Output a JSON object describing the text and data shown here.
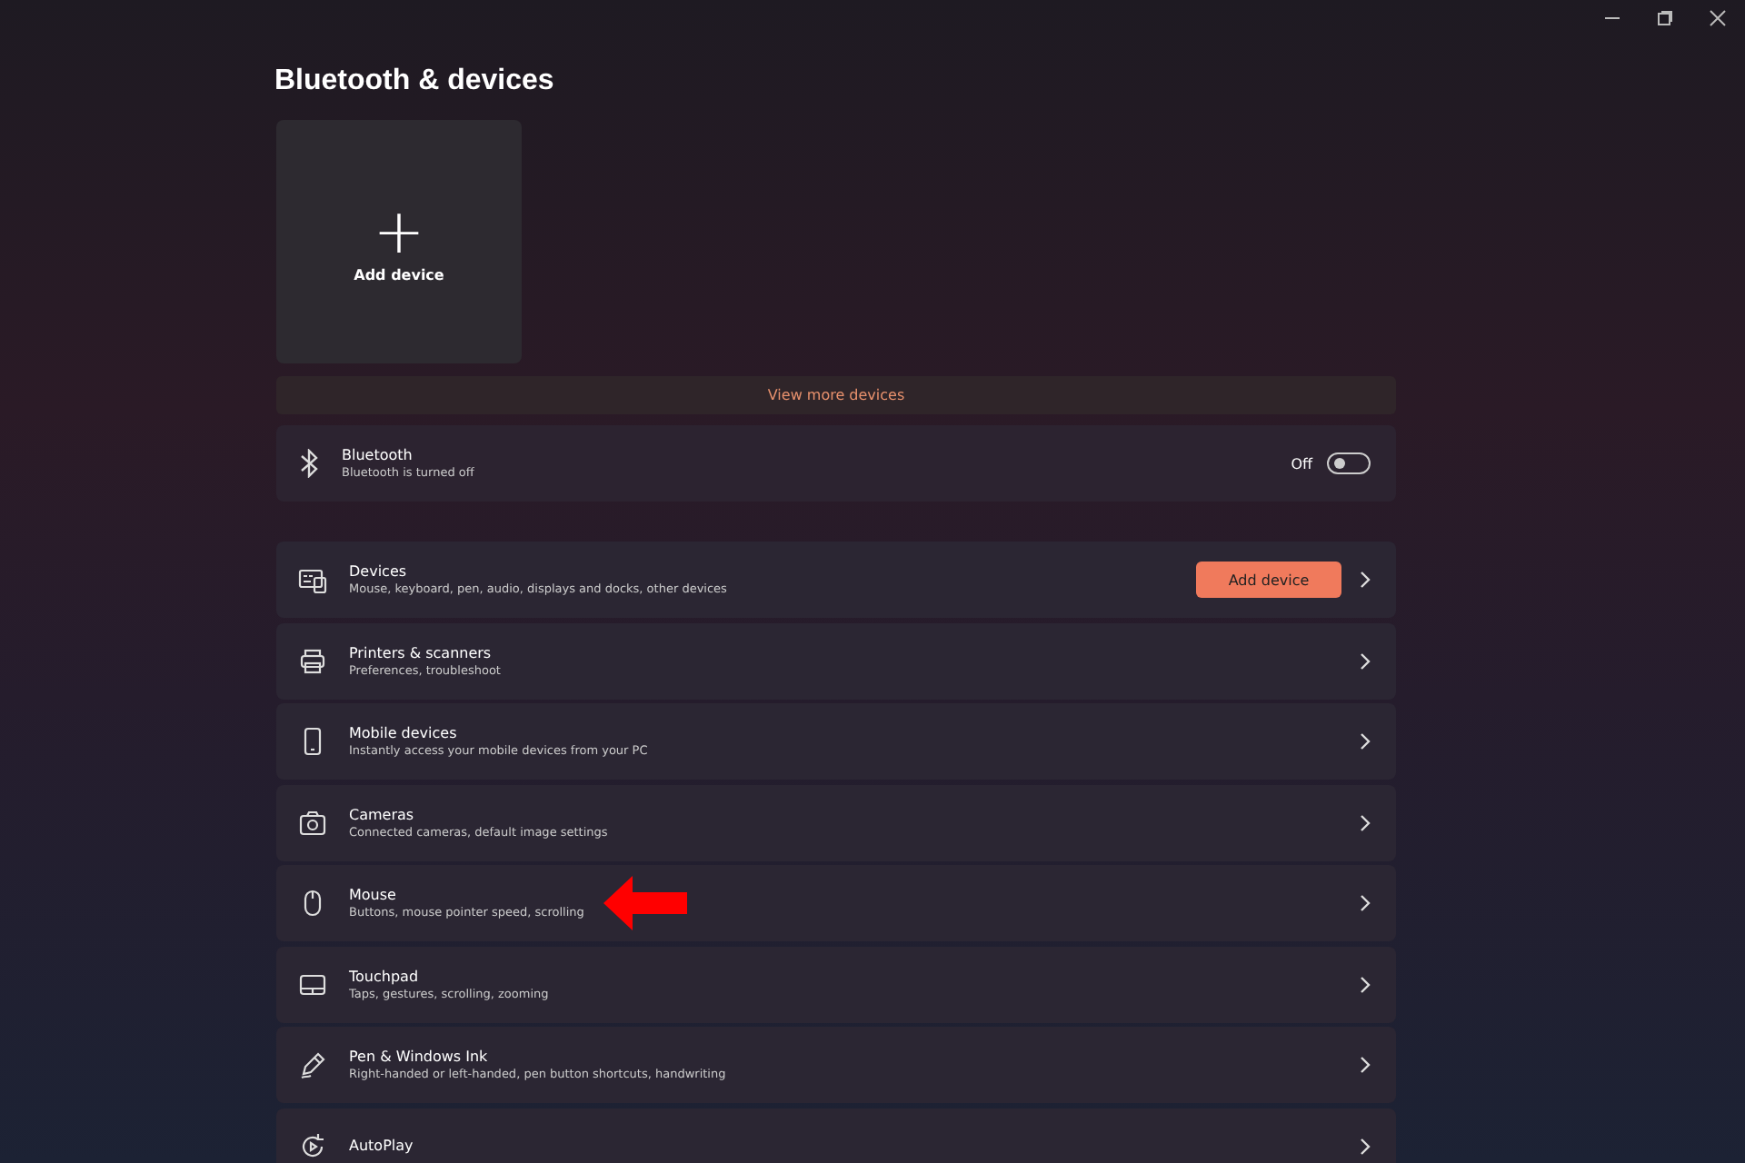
{
  "page_title": "Bluetooth & devices",
  "add_tile": {
    "plus": "+",
    "label": "Add device"
  },
  "view_more": "View more devices",
  "bluetooth": {
    "title": "Bluetooth",
    "subtitle": "Bluetooth is turned off",
    "state_label": "Off",
    "on": false
  },
  "items": [
    {
      "title": "Devices",
      "subtitle": "Mouse, keyboard, pen, audio, displays and docks, other devices",
      "button": "Add device",
      "highlighted": false
    },
    {
      "title": "Printers & scanners",
      "subtitle": "Preferences, troubleshoot",
      "highlighted": false
    },
    {
      "title": "Mobile devices",
      "subtitle": "Instantly access your mobile devices from your PC",
      "highlighted": false
    },
    {
      "title": "Cameras",
      "subtitle": "Connected cameras, default image settings",
      "highlighted": false
    },
    {
      "title": "Mouse",
      "subtitle": "Buttons, mouse pointer speed, scrolling",
      "highlighted": true
    },
    {
      "title": "Touchpad",
      "subtitle": "Taps, gestures, scrolling, zooming",
      "highlighted": false
    },
    {
      "title": "Pen & Windows Ink",
      "subtitle": "Right-handed or left-handed, pen button shortcuts, handwriting",
      "highlighted": false
    },
    {
      "title": "AutoPlay",
      "highlighted": false
    }
  ]
}
